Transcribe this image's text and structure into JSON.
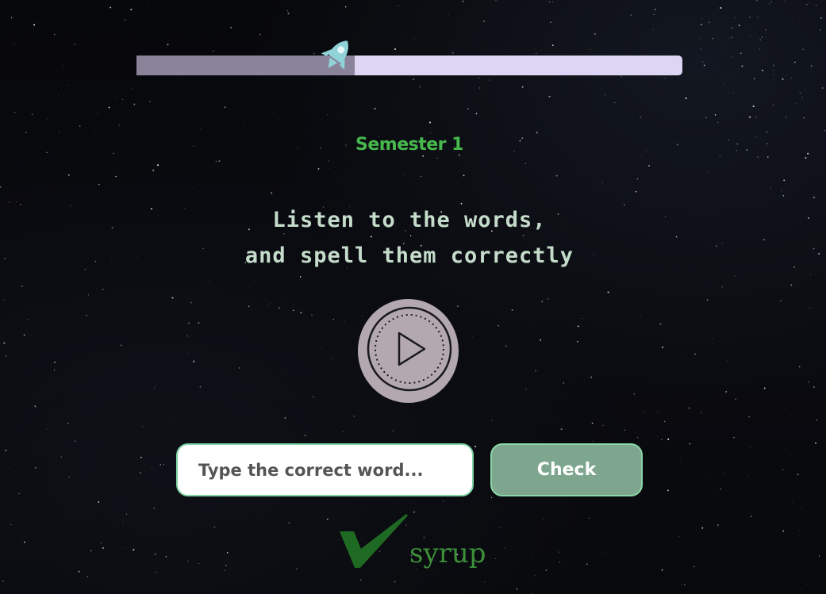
{
  "progress": {
    "fraction": 0.4,
    "track_color": "#ddd5f3",
    "fill_color": "#8a8399",
    "marker_icon": "rocket-icon",
    "marker_color": "#8fd3d8"
  },
  "semester": {
    "label": "Semester 1"
  },
  "instructions": {
    "line1": "Listen to the words,",
    "line2": "and spell them correctly"
  },
  "audio": {
    "icon": "play-icon"
  },
  "answer": {
    "placeholder": "Type the correct word...",
    "value": ""
  },
  "check_button": {
    "label": "Check"
  },
  "result": {
    "icon": "checkmark-icon",
    "word": "syrup",
    "color": "#3d8f3a"
  }
}
